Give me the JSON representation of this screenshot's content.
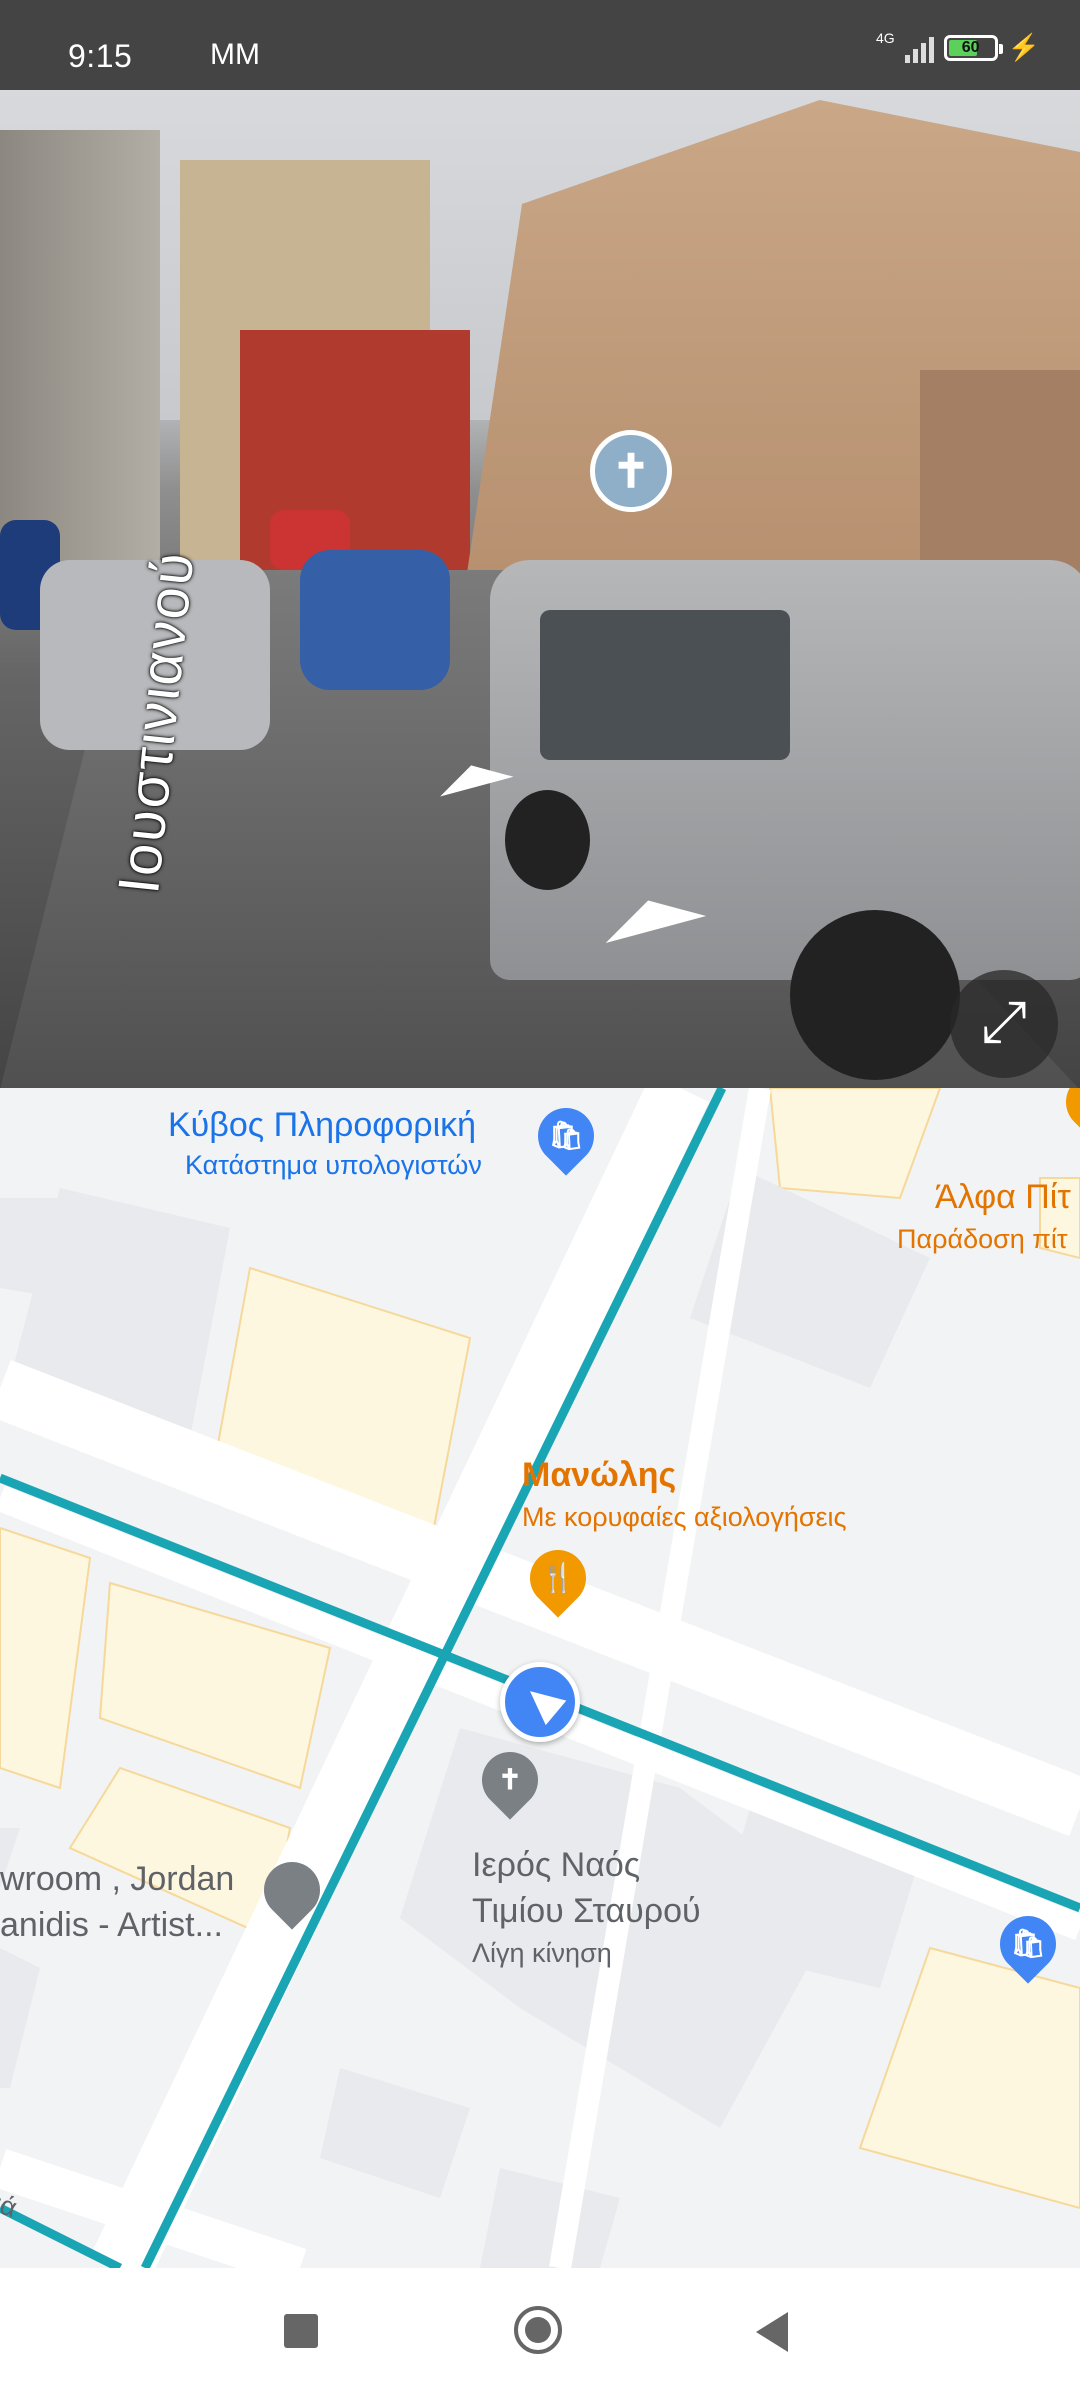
{
  "status_bar": {
    "time": "9:15",
    "extra": "MM",
    "network": "4G",
    "battery": "60"
  },
  "street_view": {
    "street_label": "Ιουστινιανού"
  },
  "map": {
    "places": [
      {
        "name": "Κύβος Πληροφορική",
        "subtitle": "Κατάστημα υπολογιστών"
      },
      {
        "name": "Άλφα Πίτ",
        "subtitle": "Παράδοση πίτ"
      },
      {
        "name": "Μανώλης",
        "subtitle": "Με κορυφαίες αξιολογήσεις"
      },
      {
        "name_line1": "Ιερός Ναός",
        "name_line2": "Τιμίου Σταυρού",
        "subtitle": "Λίγη κίνηση"
      },
      {
        "name_line1": "wroom , Jordan",
        "name_line2": "anidis -  Artist..."
      }
    ],
    "street_fragment": "ιά"
  },
  "icons": {
    "church": "✝",
    "restaurant": "🍴",
    "shopping": "🛍",
    "expand": "⤢"
  }
}
